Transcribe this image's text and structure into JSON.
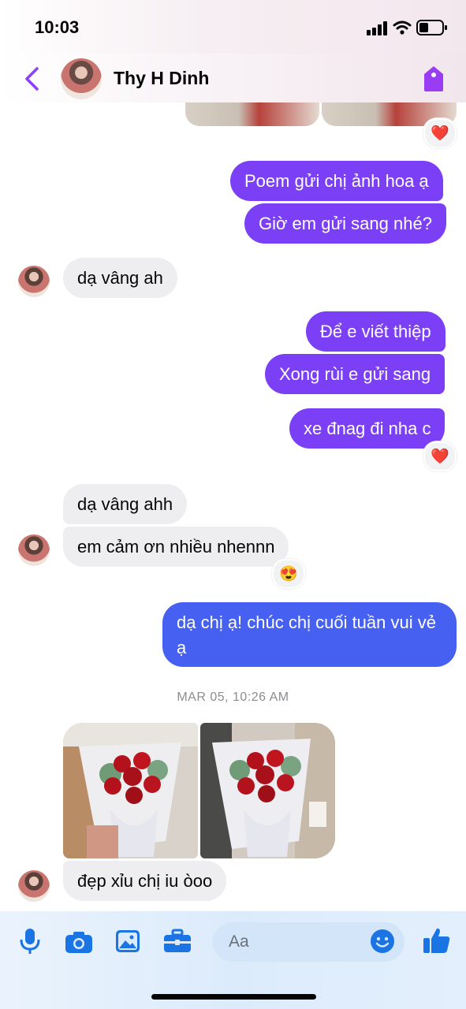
{
  "status_bar": {
    "time": "10:03"
  },
  "header": {
    "contact_name": "Thy H Dinh"
  },
  "messages": [
    {
      "dir": "out",
      "text": "Poem gửi chị ảnh hoa ạ"
    },
    {
      "dir": "out",
      "text": "Giờ em gửi sang nhé?"
    },
    {
      "dir": "in",
      "text": "dạ vâng ah"
    },
    {
      "dir": "out",
      "text": "Để e viết thiệp"
    },
    {
      "dir": "out",
      "text": "Xong rùi e gửi sang"
    },
    {
      "dir": "out",
      "text": "xe đnag đi nha c"
    },
    {
      "dir": "in",
      "text": "dạ vâng ahh"
    },
    {
      "dir": "in",
      "text": "em cảm ơn nhiều nhennn"
    },
    {
      "dir": "out",
      "text": "dạ chị ạ! chúc chị cuối tuần vui vẻ ạ"
    },
    {
      "dir": "in",
      "text": "đẹp xỉu chị iu òoo"
    }
  ],
  "reactions": {
    "heart": "❤️",
    "heart_eyes": "😍"
  },
  "timestamp": "MAR 05, 10:26 AM",
  "composer": {
    "placeholder": "Aa",
    "icons": [
      "microphone-icon",
      "camera-icon",
      "gallery-icon",
      "toolbox-icon",
      "emoji-icon",
      "thumbs-up-icon"
    ]
  },
  "colors": {
    "outgoing_purple": "#7b40f5",
    "outgoing_blue": "#4660f2",
    "accent": "#8a3ffc",
    "composer_blue": "#1b74e4"
  }
}
